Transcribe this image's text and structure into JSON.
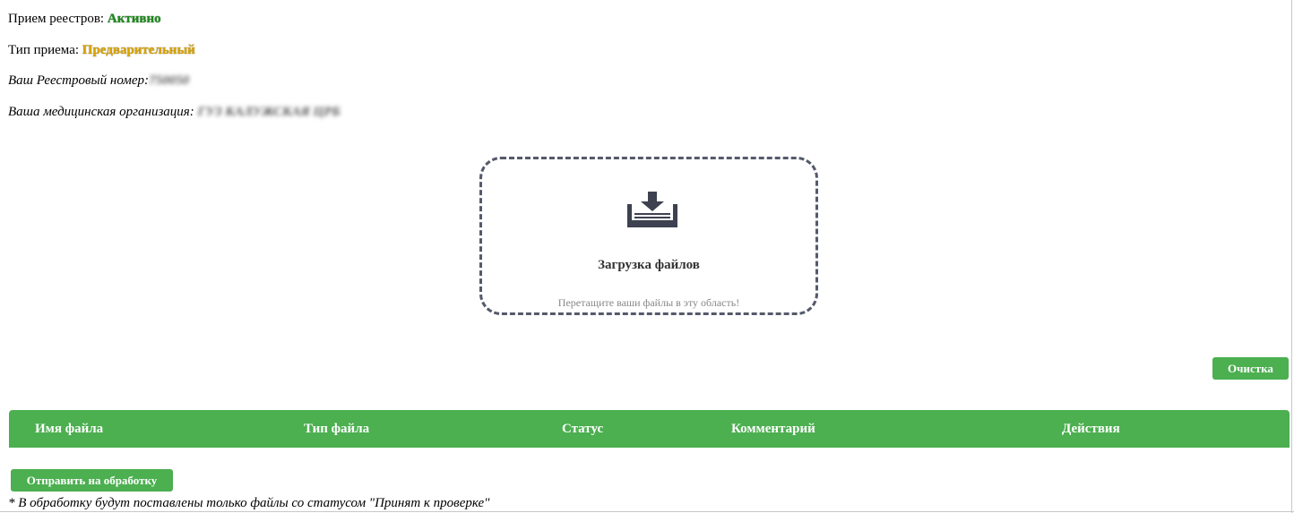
{
  "registry_intake": {
    "label": "Прием реестров:",
    "value": "Активно"
  },
  "intake_type": {
    "label": "Тип приема:",
    "value": "Предварительный"
  },
  "registry_number": {
    "label": "Ваш Реестровый номер:",
    "value": "750050"
  },
  "medical_org": {
    "label": "Ваша медицинская организация:",
    "value": "ГУЗ КАЛУЖСКАЯ ЦРБ"
  },
  "dropzone": {
    "icon": "download-tray-icon",
    "title": "Загрузка файлов",
    "hint": "Перетащите ваши файлы в эту область!"
  },
  "clear_button": "Очистка",
  "table": {
    "columns": [
      "Имя файла",
      "Тип файла",
      "Статус",
      "Комментарий",
      "Действия"
    ]
  },
  "send_button": "Отправить на обработку",
  "footnote": "* В обработку будут поставлены только файлы со статусом \"Принят к проверке\"",
  "colors": {
    "accent": "#4caf50",
    "active": "#1f8a1f",
    "type": "#d9a400"
  }
}
